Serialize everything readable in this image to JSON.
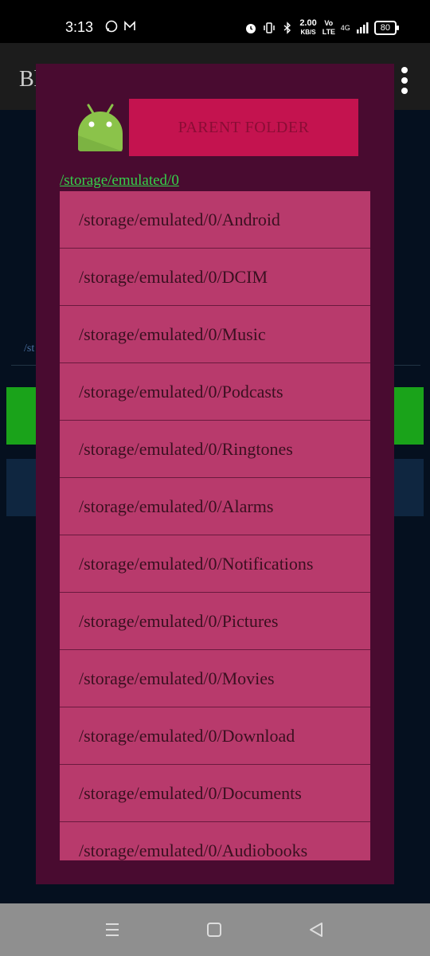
{
  "status_bar": {
    "time": "3:13",
    "net_speed_value": "2.00",
    "net_speed_unit": "KB/S",
    "volte": "Vo LTE",
    "network": "4G",
    "battery": "80"
  },
  "app": {
    "title": "Bl",
    "bg_path": "/st"
  },
  "dialog": {
    "parent_button": "PARENT FOLDER",
    "current_path": "/storage/emulated/0",
    "items": [
      "/storage/emulated/0/Android",
      "/storage/emulated/0/DCIM",
      "/storage/emulated/0/Music",
      "/storage/emulated/0/Podcasts",
      "/storage/emulated/0/Ringtones",
      "/storage/emulated/0/Alarms",
      "/storage/emulated/0/Notifications",
      "/storage/emulated/0/Pictures",
      "/storage/emulated/0/Movies",
      "/storage/emulated/0/Download",
      "/storage/emulated/0/Documents",
      "/storage/emulated/0/Audiobooks"
    ]
  },
  "colors": {
    "dialog_bg": "#490b30",
    "parent_button": "#c4134f",
    "list_item": "#b83a6c",
    "path_text": "#35d14a",
    "android_green": "#8bc34a"
  }
}
